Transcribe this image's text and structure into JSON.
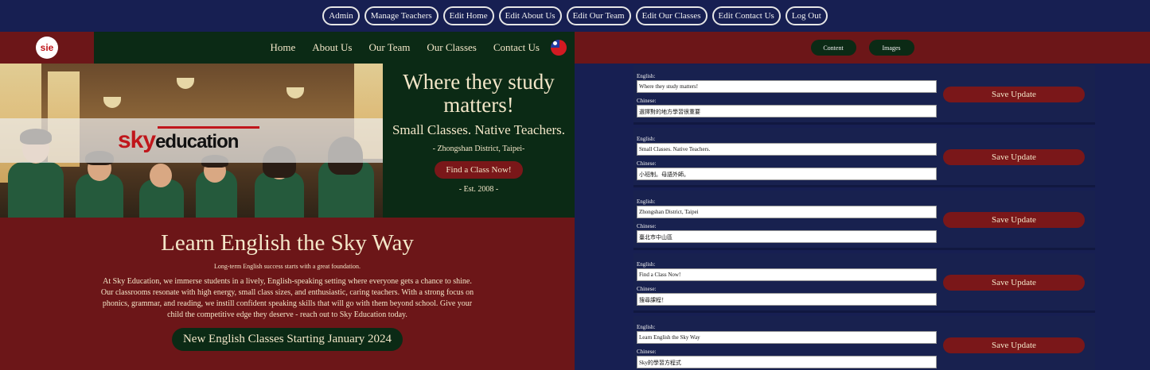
{
  "admin_nav": [
    "Admin",
    "Manage Teachers",
    "Edit Home",
    "Edit About Us",
    "Edit Our Team",
    "Edit Our Classes",
    "Edit Contact Us",
    "Log Out"
  ],
  "site": {
    "logo_text": "sie",
    "nav": [
      "Home",
      "About Us",
      "Our Team",
      "Our Classes",
      "Contact Us"
    ],
    "banner_brand_sky": "sky",
    "banner_brand_rest": "education",
    "hero": {
      "title": "Where they study matters!",
      "subtitle": "Small Classes. Native Teachers.",
      "location": "- Zhongshan District, Taipei-",
      "cta": "Find a Class Now!",
      "est": "- Est. 2008 -"
    },
    "about": {
      "heading": "Learn English the Sky Way",
      "tagline": "Long-term English success starts with a great foundation.",
      "paragraph": "At Sky Education, we immerse students in a lively, English-speaking setting where everyone gets a chance to shine. Our classrooms resonate with high energy, small class sizes, and enthusiastic, caring teachers. With a strong focus on phonics, grammar, and reading, we instill confident speaking skills that will go with them beyond school. Give your child the competitive edge they deserve - reach out to Sky Education today.",
      "announcement": "New English Classes Starting January 2024"
    }
  },
  "editor": {
    "tabs": [
      "Content",
      "Images"
    ],
    "english_label": "English:",
    "chinese_label": "Chinese:",
    "save_label": "Save Update",
    "entries": [
      {
        "english": "Where they study matters!",
        "chinese": "選擇對的地方學習很重要"
      },
      {
        "english": "Small Classes. Native Teachers.",
        "chinese": "小班制。母語外師。"
      },
      {
        "english": "Zhongshan District, Taipei",
        "chinese": "臺北市中山區"
      },
      {
        "english": "Find a Class Now!",
        "chinese": "搜尋課程！"
      },
      {
        "english": "Learn English the Sky Way",
        "chinese": "Sky的學習方程式"
      }
    ]
  },
  "colors": {
    "navy": "#171f52",
    "maroon": "#6c1618",
    "dark_green": "#0b2a15",
    "cream": "#f3e6c8"
  }
}
